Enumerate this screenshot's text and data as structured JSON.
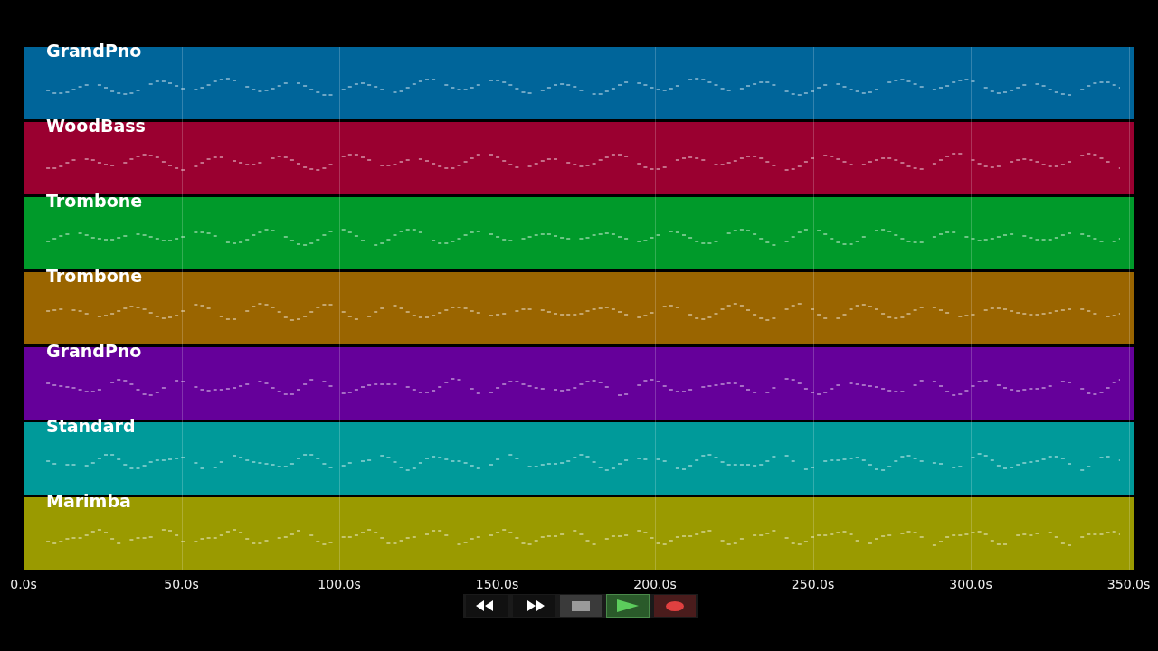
{
  "tracks": [
    {
      "name": "GrandPno",
      "color": "#00659a"
    },
    {
      "name": "WoodBass",
      "color": "#9a0030"
    },
    {
      "name": "Trombone",
      "color": "#009a2a"
    },
    {
      "name": "Trombone",
      "color": "#9a6500"
    },
    {
      "name": "GrandPno",
      "color": "#65009a"
    },
    {
      "name": "Standard",
      "color": "#009a9a"
    },
    {
      "name": "Marimba",
      "color": "#9a9a00"
    }
  ],
  "time_axis": {
    "ticks": [
      "0.0s",
      "50.0s",
      "100.0s",
      "150.0s",
      "200.0s",
      "250.0s",
      "300.0s",
      "350.0s"
    ]
  },
  "transport": [
    {
      "kind": "rewind",
      "selected": false
    },
    {
      "kind": "forward",
      "selected": false
    },
    {
      "kind": "stop",
      "selected": false
    },
    {
      "kind": "play",
      "selected": true
    },
    {
      "kind": "record",
      "selected": false
    }
  ]
}
